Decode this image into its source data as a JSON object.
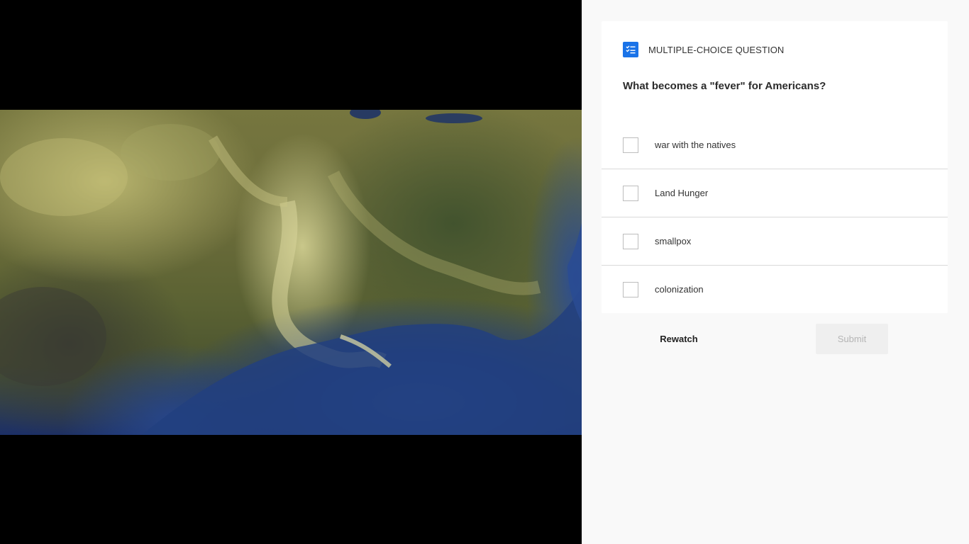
{
  "video": {
    "content": "satellite view of the southeastern United States and the Gulf of Mexico"
  },
  "question": {
    "type_icon": "checklist-icon",
    "type_label": "MULTIPLE-CHOICE QUESTION",
    "text": "What becomes a \"fever\" for Americans?",
    "options": [
      {
        "label": "war with the natives",
        "checked": false
      },
      {
        "label": "Land Hunger",
        "checked": false
      },
      {
        "label": "smallpox",
        "checked": false
      },
      {
        "label": "colonization",
        "checked": false
      }
    ]
  },
  "actions": {
    "rewatch_label": "Rewatch",
    "submit_label": "Submit",
    "submit_enabled": false
  },
  "colors": {
    "accent": "#1a73e8",
    "panel_bg": "#f9f9f9",
    "card_bg": "#ffffff",
    "video_bg": "#000000",
    "submit_disabled_bg": "#efefef",
    "submit_disabled_text": "#b5b5b5"
  }
}
